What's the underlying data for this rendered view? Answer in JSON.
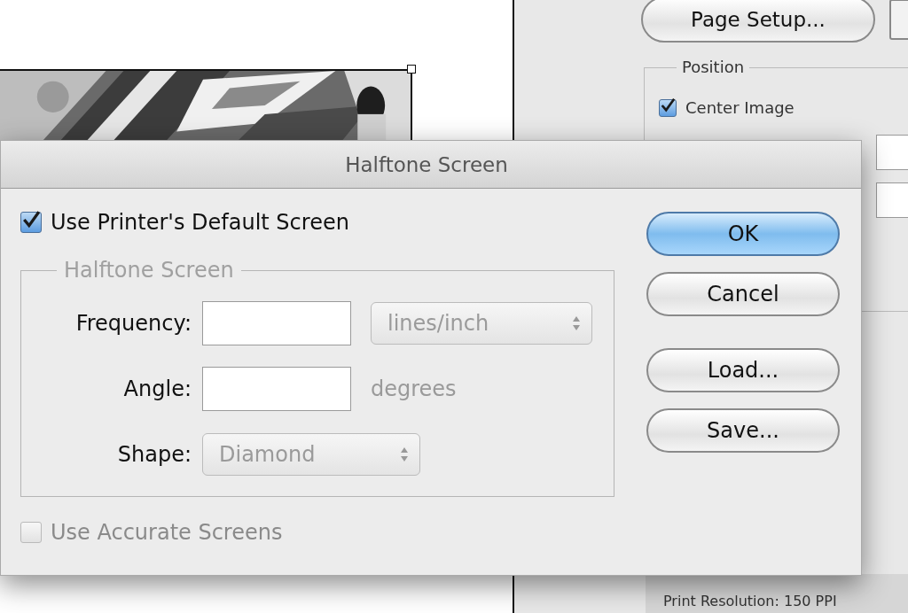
{
  "background": {
    "page_setup_button": "Page Setup...",
    "position_group": {
      "title": "Position",
      "center_image": {
        "label": "Center Image",
        "checked": true
      }
    },
    "print_resolution": "Print Resolution: 150 PPI"
  },
  "dialog": {
    "title": "Halftone Screen",
    "use_default": {
      "label": "Use Printer's Default Screen",
      "checked": true
    },
    "group": {
      "title": "Halftone Screen",
      "disabled": true,
      "frequency": {
        "label": "Frequency:",
        "unit": "lines/inch"
      },
      "angle": {
        "label": "Angle:",
        "unit": "degrees"
      },
      "shape": {
        "label": "Shape:",
        "value": "Diamond"
      }
    },
    "accurate": {
      "label": "Use Accurate Screens",
      "checked": false,
      "disabled": true
    },
    "buttons": [
      {
        "label": "OK",
        "default": true
      },
      {
        "label": "Cancel",
        "default": false
      },
      {
        "label": "Load...",
        "default": false
      },
      {
        "label": "Save...",
        "default": false
      }
    ]
  }
}
